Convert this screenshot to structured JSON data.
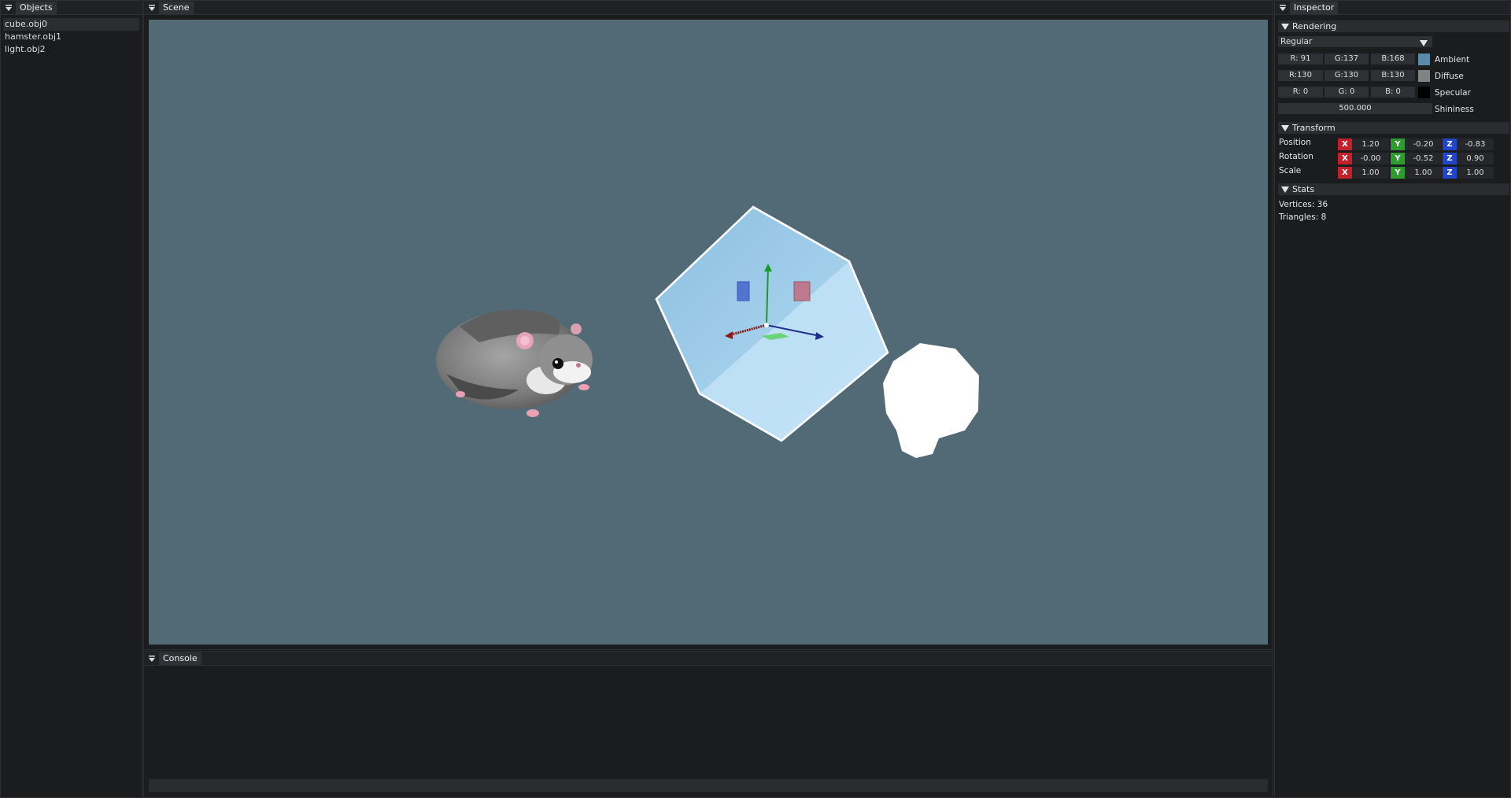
{
  "objects_panel": {
    "title": "Objects",
    "items": [
      "cube.obj0",
      "hamster.obj1",
      "light.obj2"
    ]
  },
  "scene_panel": {
    "title": "Scene",
    "background_color": "#526a76"
  },
  "console_panel": {
    "title": "Console",
    "input_value": ""
  },
  "inspector": {
    "title": "Inspector",
    "rendering": {
      "section_label": "Rendering",
      "mode": "Regular",
      "ambient": {
        "r": "R: 91",
        "g": "G:137",
        "b": "B:168",
        "label": "Ambient",
        "color": "#5b89a8"
      },
      "diffuse": {
        "r": "R:130",
        "g": "G:130",
        "b": "B:130",
        "label": "Diffuse",
        "color": "#828282"
      },
      "specular": {
        "r": "R:  0",
        "g": "G:  0",
        "b": "B:  0",
        "label": "Specular",
        "color": "#000000"
      },
      "shininess": {
        "value": "500.000",
        "label": "Shininess"
      }
    },
    "transform": {
      "section_label": "Transform",
      "axis_labels": {
        "x": "X",
        "y": "Y",
        "z": "Z"
      },
      "axis_colors": {
        "x": "#c2202a",
        "y": "#2f9a2f",
        "z": "#2244c8"
      },
      "position": {
        "label": "Position",
        "x": "1.20",
        "y": "-0.20",
        "z": "-0.83"
      },
      "rotation": {
        "label": "Rotation",
        "x": "-0.00",
        "y": "-0.52",
        "z": "0.90"
      },
      "scale": {
        "label": "Scale",
        "x": "1.00",
        "y": "1.00",
        "z": "1.00"
      }
    },
    "stats": {
      "section_label": "Stats",
      "vertices": "Vertices: 36",
      "triangles": "Triangles: 8"
    }
  }
}
